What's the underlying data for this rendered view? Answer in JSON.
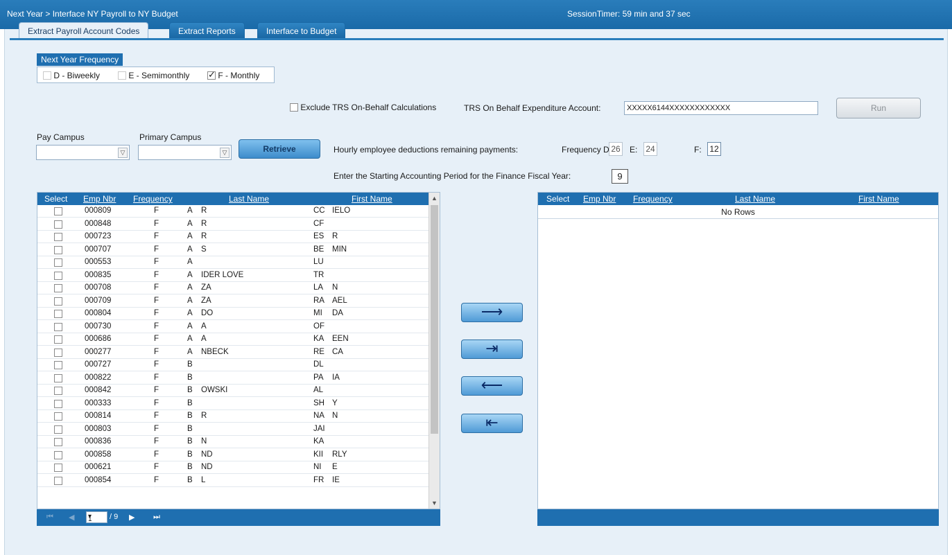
{
  "header": {
    "breadcrumb": "Next Year > Interface NY Payroll to NY Budget",
    "session_timer": "SessionTimer: 59 min and 37 sec"
  },
  "tabs": [
    {
      "label": "Extract Payroll Account Codes",
      "active": true
    },
    {
      "label": "Extract Reports",
      "active": false
    },
    {
      "label": "Interface to Budget",
      "active": false
    }
  ],
  "frequency": {
    "title": "Next Year Frequency",
    "options": [
      {
        "label": "D - Biweekly",
        "checked": false
      },
      {
        "label": "E - Semimonthly",
        "checked": false
      },
      {
        "label": "F - Monthly",
        "checked": true
      }
    ]
  },
  "exclude_trs": {
    "label": "Exclude TRS On-Behalf Calculations",
    "checked": false
  },
  "trs_account": {
    "label": "TRS On Behalf Expenditure Account:",
    "value": "XXXXX6144XXXXXXXXXXXX"
  },
  "run_button": "Run",
  "pay_campus": {
    "label": "Pay Campus",
    "value": ""
  },
  "primary_campus": {
    "label": "Primary Campus",
    "value": ""
  },
  "retrieve_button": "Retrieve",
  "deductions": {
    "label": "Hourly employee deductions remaining payments:",
    "freq_d_label": "Frequency D:",
    "freq_d": "26",
    "e_label": "E:",
    "e": "24",
    "f_label": "F:",
    "f": "12"
  },
  "accounting_period": {
    "label": "Enter the Starting Accounting Period for the Finance Fiscal Year:",
    "value": "9"
  },
  "left_grid": {
    "columns": [
      "Select",
      "Emp Nbr",
      "Frequency",
      "Last Name",
      "First Name"
    ],
    "rows": [
      {
        "emp": "000809",
        "freq": "F",
        "l1": "A",
        "l2": "R",
        "f1": "CC",
        "f2": "IELO"
      },
      {
        "emp": "000848",
        "freq": "F",
        "l1": "A",
        "l2": "R",
        "f1": "CF",
        "f2": ""
      },
      {
        "emp": "000723",
        "freq": "F",
        "l1": "A",
        "l2": "R",
        "f1": "ES",
        "f2": "R"
      },
      {
        "emp": "000707",
        "freq": "F",
        "l1": "A",
        "l2": "S",
        "f1": "BE",
        "f2": "MIN"
      },
      {
        "emp": "000553",
        "freq": "F",
        "l1": "A",
        "l2": "",
        "f1": "LU",
        "f2": ""
      },
      {
        "emp": "000835",
        "freq": "F",
        "l1": "A",
        "l2": "IDER LOVE",
        "f1": "TR",
        "f2": ""
      },
      {
        "emp": "000708",
        "freq": "F",
        "l1": "A",
        "l2": "ZA",
        "f1": "LA",
        "f2": "N"
      },
      {
        "emp": "000709",
        "freq": "F",
        "l1": "A",
        "l2": "ZA",
        "f1": "RA",
        "f2": "AEL"
      },
      {
        "emp": "000804",
        "freq": "F",
        "l1": "A",
        "l2": "DO",
        "f1": "MI",
        "f2": "DA"
      },
      {
        "emp": "000730",
        "freq": "F",
        "l1": "A",
        "l2": "A",
        "f1": "OF",
        "f2": ""
      },
      {
        "emp": "000686",
        "freq": "F",
        "l1": "A",
        "l2": "A",
        "f1": "KA",
        "f2": "EEN"
      },
      {
        "emp": "000277",
        "freq": "F",
        "l1": "A",
        "l2": "NBECK",
        "f1": "RE",
        "f2": "CA"
      },
      {
        "emp": "000727",
        "freq": "F",
        "l1": "B",
        "l2": "",
        "f1": "DL",
        "f2": ""
      },
      {
        "emp": "000822",
        "freq": "F",
        "l1": "B",
        "l2": "",
        "f1": "PA",
        "f2": "IA"
      },
      {
        "emp": "000842",
        "freq": "F",
        "l1": "B",
        "l2": "OWSKI",
        "f1": "AL",
        "f2": ""
      },
      {
        "emp": "000333",
        "freq": "F",
        "l1": "B",
        "l2": "",
        "f1": "SH",
        "f2": "Y"
      },
      {
        "emp": "000814",
        "freq": "F",
        "l1": "B",
        "l2": "R",
        "f1": "NA",
        "f2": "N"
      },
      {
        "emp": "000803",
        "freq": "F",
        "l1": "B",
        "l2": "",
        "f1": "JAI",
        "f2": ""
      },
      {
        "emp": "000836",
        "freq": "F",
        "l1": "B",
        "l2": "N",
        "f1": "KA",
        "f2": ""
      },
      {
        "emp": "000858",
        "freq": "F",
        "l1": "B",
        "l2": "ND",
        "f1": "KII",
        "f2": "RLY"
      },
      {
        "emp": "000621",
        "freq": "F",
        "l1": "B",
        "l2": "ND",
        "f1": "NI",
        "f2": "E"
      },
      {
        "emp": "000854",
        "freq": "F",
        "l1": "B",
        "l2": "L",
        "f1": "FR",
        "f2": "IE"
      }
    ],
    "pager": {
      "page": "1",
      "total": "/ 9"
    }
  },
  "right_grid": {
    "columns": [
      "Select",
      "Emp Nbr",
      "Frequency",
      "Last Name",
      "First Name"
    ],
    "empty_text": "No Rows"
  },
  "move_buttons": {
    "move_one": "⟶",
    "move_all": "⇥",
    "remove_one": "⟵",
    "remove_all": "⇤"
  }
}
